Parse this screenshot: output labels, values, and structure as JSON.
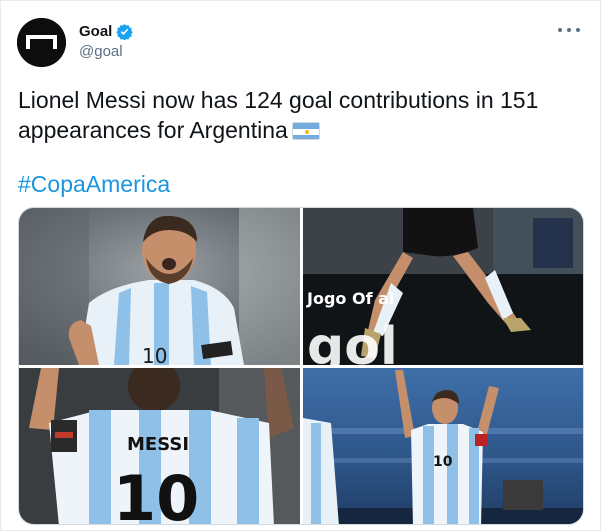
{
  "account": {
    "display_name": "Goal",
    "handle": "@goal",
    "avatar_icon": "goal-logo-icon",
    "verified_icon": "verified-badge-icon"
  },
  "tweet": {
    "text": "Lionel Messi now has 124 goal contributions in 151 appearances for Argentina",
    "emoji_icon": "argentina-flag-icon",
    "hashtag": "#CopaAmerica"
  },
  "media": {
    "photos": [
      {
        "name": "messi-celebrating-photo",
        "jersey_number": "10"
      },
      {
        "name": "messi-jumping-photo",
        "board_text": "Jogo Of  al",
        "board_text_2": "gol"
      },
      {
        "name": "messi-back-photo",
        "jersey_name": "MESSI",
        "jersey_number": "10"
      },
      {
        "name": "messi-pointing-up-photo",
        "jersey_number": "10"
      }
    ]
  },
  "colors": {
    "text": "#0f1419",
    "secondary": "#5b7083",
    "link": "#1b95e0",
    "verified": "#1da1f2",
    "flag_blue": "#74acdf"
  }
}
